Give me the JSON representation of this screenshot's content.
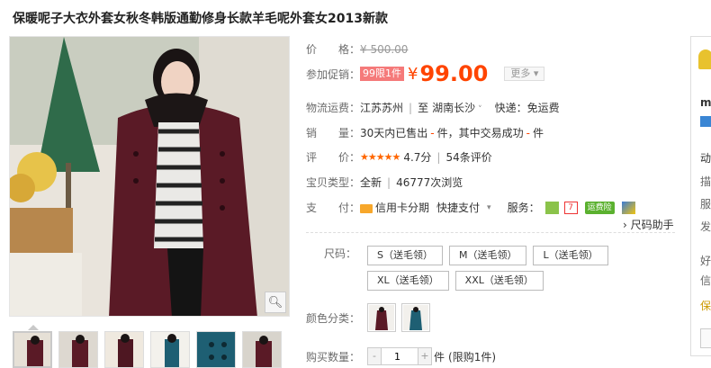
{
  "title": "保暖呢子大衣外套女秋冬韩版通勤修身长款羊毛呢外套女2013新款",
  "price": {
    "label": "价　　格：",
    "original": "¥ 500.00"
  },
  "promo": {
    "label": "参加促销：",
    "tag": "99限1件",
    "currency": "¥",
    "price": "99.00",
    "more": "更多"
  },
  "shipping": {
    "label": "物流运费：",
    "from": "江苏苏州",
    "to_prefix": "至",
    "to": "湖南长沙",
    "express": "快递：免运费"
  },
  "sales": {
    "label": "销　　量：",
    "prefix": "30天内已售出",
    "count1": "-",
    "mid": "件，其中交易成功",
    "count2": "-",
    "suffix": "件"
  },
  "rating": {
    "label": "评　　价：",
    "stars": "★★★★★",
    "score": "4.7分",
    "reviews": "54条评价"
  },
  "condition": {
    "label": "宝贝类型：",
    "value": "全新",
    "views": "46777次浏览"
  },
  "payment": {
    "label": "支　　付：",
    "card": "信用卡分期",
    "quick": "快捷支付",
    "service_label": "服务：",
    "insurance": "运费险"
  },
  "size_helper": "尺码助手",
  "size": {
    "label": "尺码：",
    "options": [
      "S（送毛领）",
      "M（送毛领）",
      "L（送毛领）",
      "XL（送毛领）",
      "XXL（送毛领）"
    ]
  },
  "color": {
    "label": "颜色分类："
  },
  "quantity": {
    "label": "购买数量：",
    "minus": "-",
    "value": "1",
    "plus": "+",
    "unit": "件",
    "limit": "(限购1件)"
  },
  "side": {
    "chars": [
      "mi",
      "动",
      "描",
      "服",
      "发",
      "好",
      "信"
    ]
  },
  "colors": {
    "accent": "#ff4400",
    "promo_tag": "#f57a7a",
    "coat_wine": "#5a1a26",
    "coat_teal": "#1e5f73"
  }
}
